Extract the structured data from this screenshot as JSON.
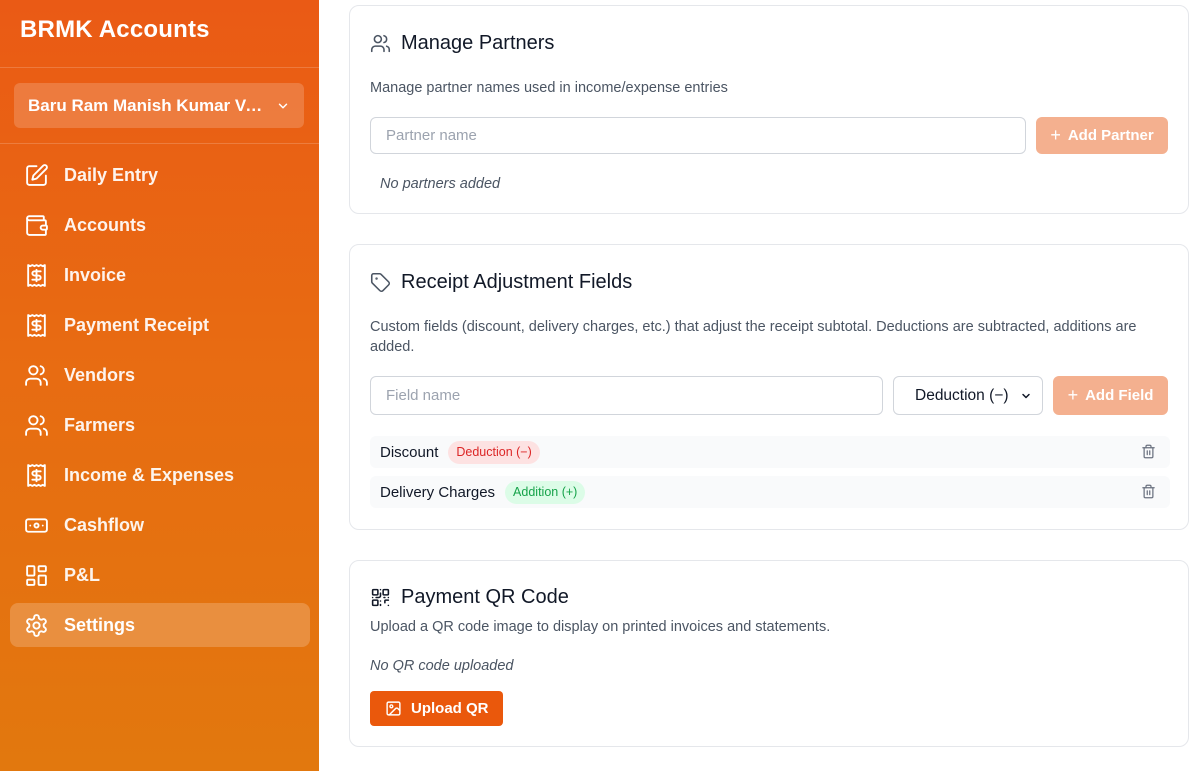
{
  "brand": "BRMK Accounts",
  "business_selector": {
    "value": "Baru Ram Manish Kumar Ve..."
  },
  "nav": [
    {
      "label": "Daily Entry",
      "icon": "edit-icon"
    },
    {
      "label": "Accounts",
      "icon": "wallet-icon"
    },
    {
      "label": "Invoice",
      "icon": "receipt-icon"
    },
    {
      "label": "Payment Receipt",
      "icon": "receipt-icon"
    },
    {
      "label": "Vendors",
      "icon": "users-icon"
    },
    {
      "label": "Farmers",
      "icon": "users-icon"
    },
    {
      "label": "Income & Expenses",
      "icon": "receipt-icon"
    },
    {
      "label": "Cashflow",
      "icon": "banknote-icon"
    },
    {
      "label": "P&L",
      "icon": "layout-grid-icon"
    },
    {
      "label": "Settings",
      "icon": "gear-icon",
      "active": true
    }
  ],
  "partners": {
    "title": "Manage Partners",
    "description": "Manage partner names used in income/expense entries",
    "input_placeholder": "Partner name",
    "add_button": "Add Partner",
    "empty_text": "No partners added"
  },
  "receipt_fields": {
    "title": "Receipt Adjustment Fields",
    "description": "Custom fields (discount, delivery charges, etc.) that adjust the receipt subtotal. Deductions are subtracted, additions are added.",
    "input_placeholder": "Field name",
    "type_select": "Deduction (−)",
    "add_button": "Add Field",
    "items": [
      {
        "name": "Discount",
        "type": "Deduction (−)",
        "kind": "deduction"
      },
      {
        "name": "Delivery Charges",
        "type": "Addition (+)",
        "kind": "addition"
      }
    ]
  },
  "qr": {
    "title": "Payment QR Code",
    "description": "Upload a QR code image to display on printed invoices and statements.",
    "empty_text": "No QR code uploaded",
    "upload_button": "Upload QR"
  },
  "colors": {
    "sidebar_gradient_top": "#ea5a15",
    "sidebar_gradient_bottom": "#e2780e",
    "accent": "#ea580c",
    "accent_soft": "#f4b08f",
    "deduction_badge": "#dc2626",
    "addition_badge": "#16a34a"
  }
}
